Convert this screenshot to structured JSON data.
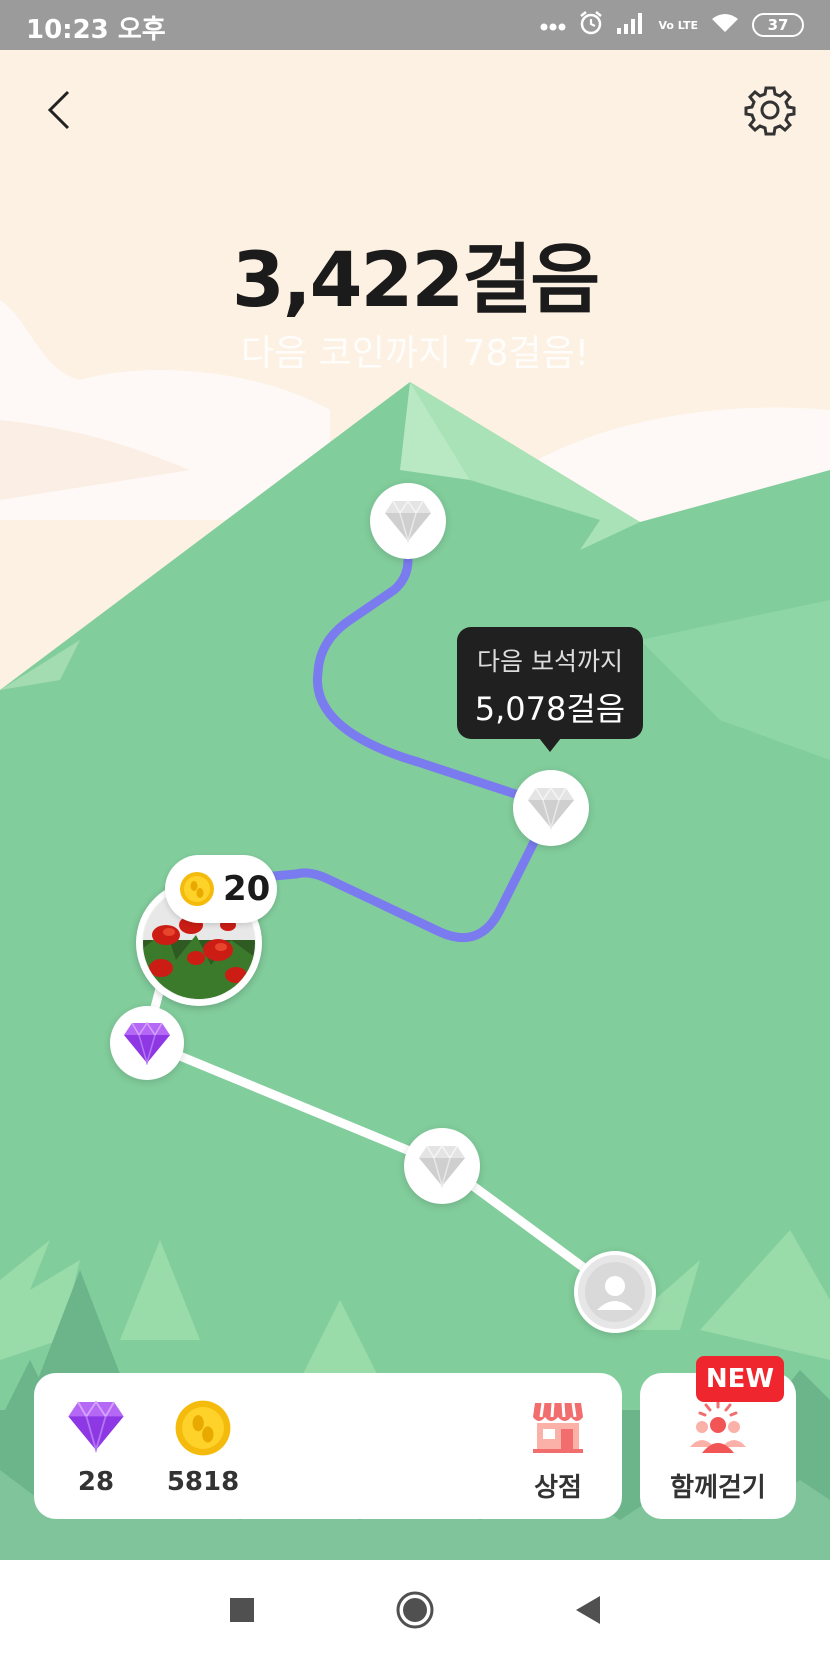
{
  "status_bar": {
    "time": "10:23 오후",
    "battery": "37",
    "network": "Vo LTE"
  },
  "header": {
    "step_count": "3,422걸음",
    "next_coin": "다음 코인까지 78걸음!"
  },
  "map": {
    "tooltip": {
      "label": "다음 보석까지",
      "value": "5,078걸음"
    },
    "coin_reward": "20"
  },
  "panel": {
    "gems": "28",
    "coins": "5818",
    "shop_label": "상점",
    "walk_together_label": "함께걷기",
    "new_badge": "NEW"
  },
  "colors": {
    "background": "#fcf1e2",
    "mountain": "#82cd9c",
    "path_active": "#7b7bf0",
    "path_inactive": "#ffffff",
    "gem_purple": "#a14cf0",
    "coin_gold": "#f7c312",
    "badge_red": "#f0262e"
  },
  "icons": [
    "back-icon",
    "settings-icon",
    "diamond-icon",
    "coin-icon",
    "shop-icon",
    "walk-together-icon",
    "profile-icon"
  ]
}
